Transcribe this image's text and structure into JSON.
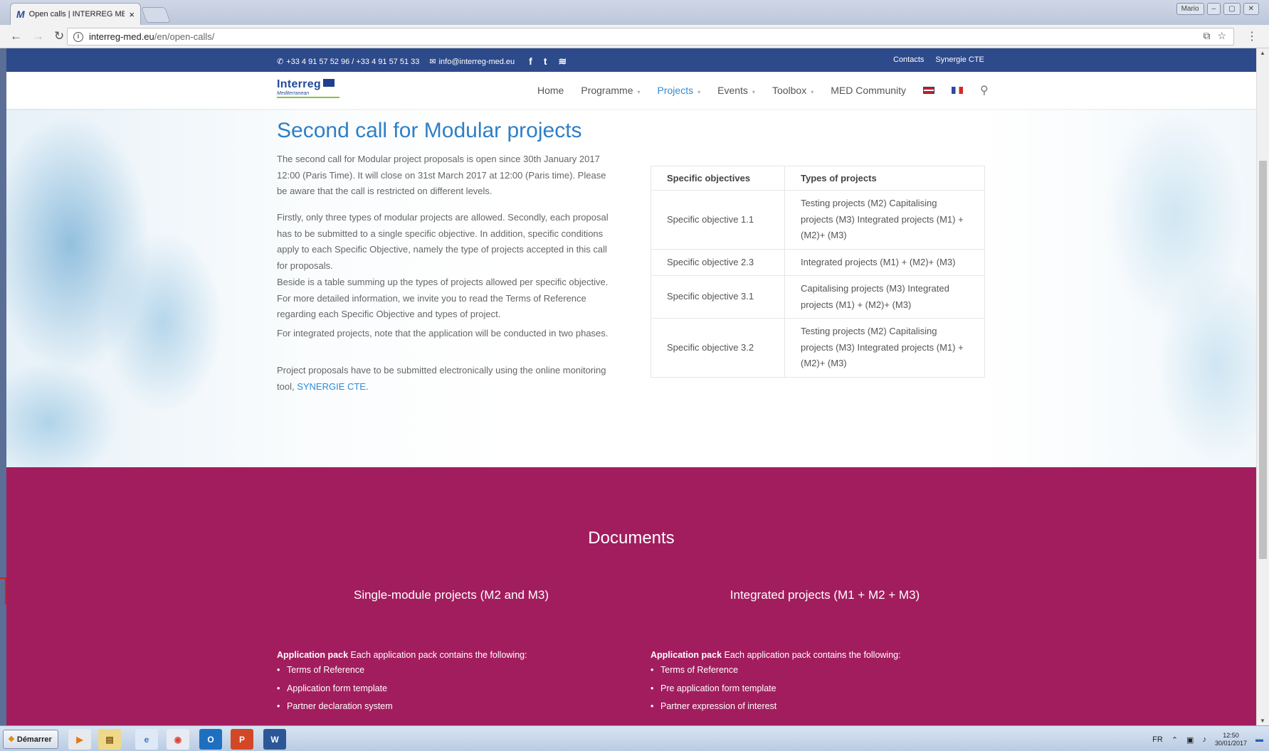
{
  "browser": {
    "tab_title": "Open calls | INTERREG ME",
    "tab_favicon": "M",
    "tab_close": "×",
    "window_user": "Mario",
    "window_controls": [
      "–",
      "▢",
      "✕"
    ],
    "url_host": "interreg-med.eu",
    "url_path": "/en/open-calls/"
  },
  "topbar": {
    "phone": "+33 4 91 57 52 96 / +33 4 91 57 51 33",
    "email": "info@interreg-med.eu",
    "links": [
      "Contacts",
      "Synergie CTE"
    ]
  },
  "logo": {
    "name": "Interreg",
    "sub": "Mediterranean"
  },
  "nav": {
    "items": [
      "Home",
      "Programme",
      "Projects",
      "Events",
      "Toolbox",
      "MED Community"
    ],
    "active": "Projects"
  },
  "main": {
    "title": "Second call for Modular projects",
    "paragraphs": [
      "The second call for Modular project proposals is open since 30th January 2017 12:00 (Paris Time). It will close on 31st March 2017 at 12:00 (Paris time). Please be aware that the call is restricted on different levels.",
      "Firstly, only three types of modular projects are allowed. Secondly, each proposal has to be submitted to a single specific objective. In addition, specific conditions apply to each Specific Objective, namely the type of projects accepted in this call for proposals.",
      "Beside is a table summing up the types of projects allowed per specific objective. For more detailed information, we invite you to read the Terms of Reference regarding each Specific Objective and types of project.",
      "For integrated projects, note that the application will be conducted in two phases."
    ],
    "last_paragraph": "Project proposals have to be submitted electronically using the online monitoring tool, ",
    "link": "SYNERGIE CTE",
    "link_after": "."
  },
  "table": {
    "headers": [
      "Specific objectives",
      "Types of projects"
    ],
    "rows": [
      [
        "Specific objective 1.1",
        "Testing projects (M2) Capitalising projects (M3) Integrated projects (M1) + (M2)+ (M3)"
      ],
      [
        "Specific objective 2.3",
        "Integrated projects (M1) + (M2)+ (M3)"
      ],
      [
        "Specific objective 3.1",
        "Capitalising projects (M3) Integrated projects (M1) + (M2)+ (M3)"
      ],
      [
        "Specific objective 3.2",
        "Testing projects (M2) Capitalising projects (M3) Integrated projects (M1) + (M2)+ (M3)"
      ]
    ]
  },
  "documents": {
    "title": "Documents",
    "columns": [
      {
        "title": "Single-module projects (M2 and M3)",
        "pack_label": "Application pack",
        "pack_text": " Each application pack contains the following:",
        "items": [
          "Terms of Reference",
          "Application form template",
          "Partner declaration system"
        ]
      },
      {
        "title": "Integrated projects (M1 + M2 + M3)",
        "pack_label": "Application pack",
        "pack_text": " Each application pack contains the following:",
        "items": [
          "Terms of Reference",
          "Pre application form template",
          "Partner expression of interest"
        ]
      }
    ]
  },
  "taskbar": {
    "start": "Démarrer",
    "lang": "FR",
    "time": "12:50",
    "date": "30/01/2017"
  },
  "colors": {
    "topbar": "#2d4a8a",
    "accent": "#2e7fc7",
    "documents_bg": "#a21d5e"
  }
}
